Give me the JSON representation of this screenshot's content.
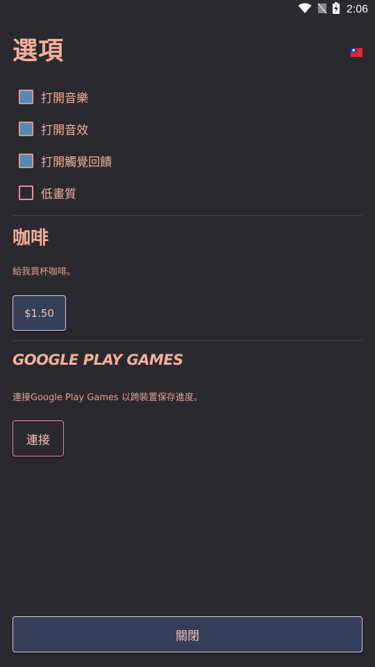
{
  "status_bar": {
    "time": "2:06",
    "icons": [
      "wifi-icon",
      "no-sim-icon",
      "battery-charging-icon"
    ]
  },
  "header": {
    "title": "選項",
    "language_flag": "taiwan-flag-icon"
  },
  "options": [
    {
      "label": "打開音樂",
      "checked": true
    },
    {
      "label": "打開音效",
      "checked": true
    },
    {
      "label": "打開觸覺回饋",
      "checked": true
    },
    {
      "label": "低畫質",
      "checked": false
    }
  ],
  "coffee": {
    "title": "咖啡",
    "description": "給我買杯咖啡。",
    "price_button": "$1.50"
  },
  "google_play_games": {
    "title": "GOOGLE PLAY GAMES",
    "description": "連接Google Play Games 以跨裝置保存進度。",
    "connect_button": "連接"
  },
  "footer": {
    "close_button": "關閉"
  },
  "colors": {
    "background": "#2b2930",
    "accent_text": "#f3b09c",
    "checkbox_border": "#e8909d",
    "checkbox_fill": "#4f8eb0",
    "button_fill": "#363e5a"
  }
}
